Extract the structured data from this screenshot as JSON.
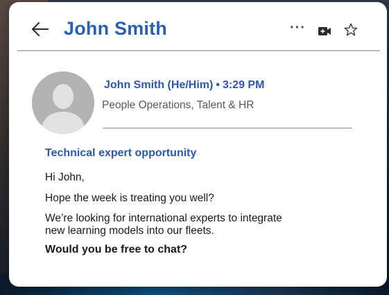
{
  "header": {
    "title": "John Smith",
    "back_icon": "arrow-left-icon",
    "more_label": "···",
    "video_icon": "video-camera-icon",
    "star_icon": "star-outline-icon"
  },
  "sender": {
    "name": "John Smith (He/Him)",
    "separator": "•",
    "time": "3:29 PM",
    "department": "People Operations, Talent & HR",
    "avatar_icon": "person-avatar-icon"
  },
  "message": {
    "subject": "Technical expert opportunity",
    "greeting": "Hi John,",
    "line1": "Hope the week is treating you well?",
    "line2a": "We’re looking for international experts to integrate",
    "line2b": "new learning models into our fleets.",
    "closing": "Would you be free to chat?"
  },
  "colors": {
    "accent": "#2b5fb4",
    "text": "#1a1a1a",
    "muted": "#5a5a5a"
  }
}
